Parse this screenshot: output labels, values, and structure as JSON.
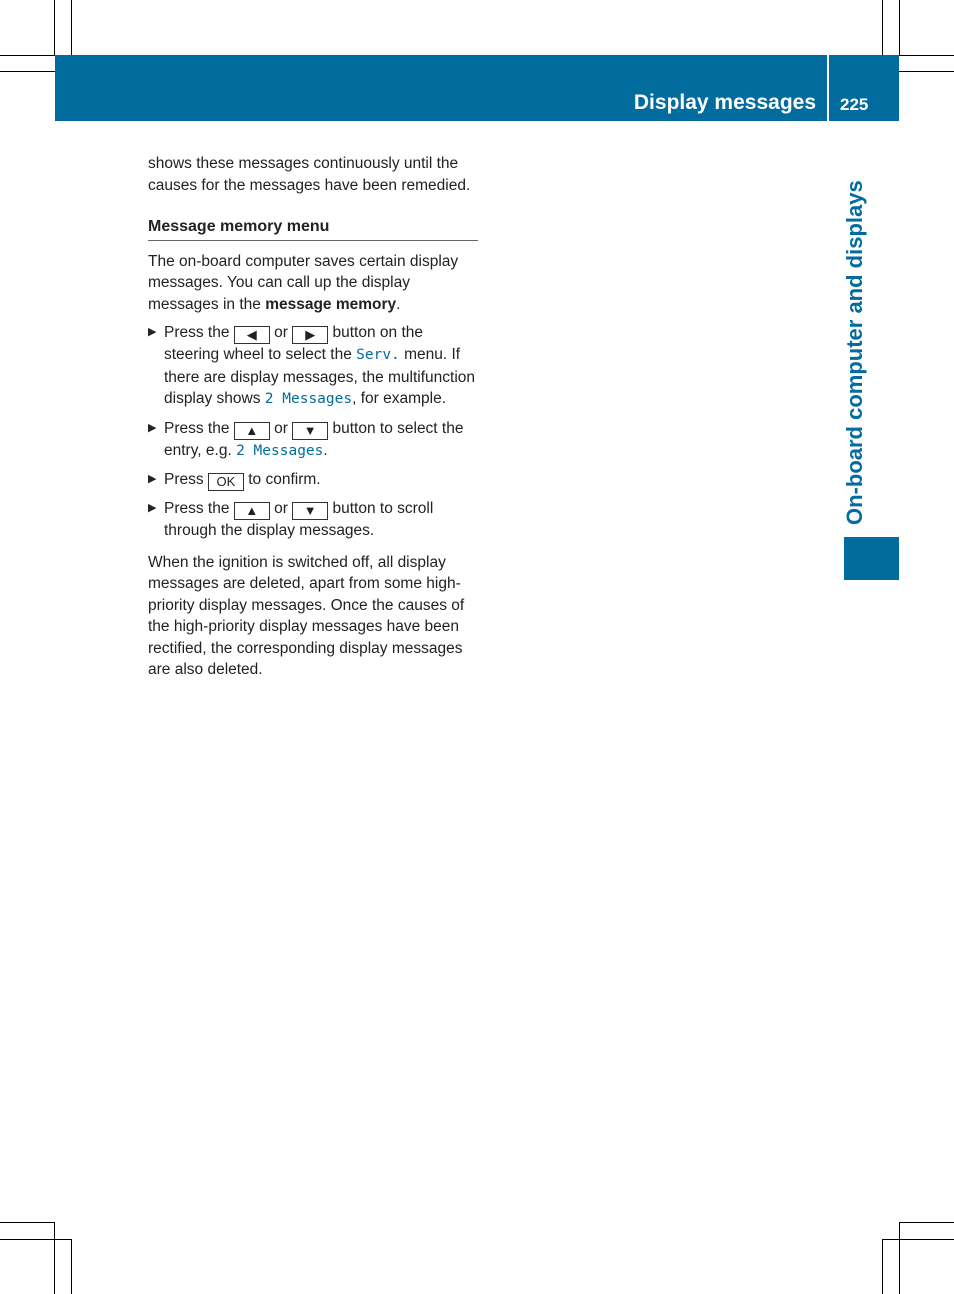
{
  "header": {
    "title": "Display messages",
    "page_number": "225"
  },
  "side_tab": {
    "label": "On-board computer and displays"
  },
  "content": {
    "intro": "shows these messages continuously until the causes for the messages have been remedied.",
    "heading": "Message memory menu",
    "para1_a": "The on-board computer saves certain display messages. You can call up the display messages in the ",
    "para1_bold": "message memory",
    "para1_b": ".",
    "steps": [
      {
        "t1": "Press the ",
        "k1": "◀",
        "or": " or ",
        "k2": "▶",
        "t2": " button on the steering wheel to select the ",
        "m1": "Serv.",
        "t3": " menu. If there are display messages, the multifunction display shows ",
        "m2": "2 Messages",
        "t4": ", for example."
      },
      {
        "t1": "Press the ",
        "k1": "▲",
        "or": " or ",
        "k2": "▼",
        "t2": " button to select the entry, e.g. ",
        "m1": "2 Messages",
        "t3": "."
      },
      {
        "t1": "Press ",
        "k1": "OK",
        "t2": " to confirm."
      },
      {
        "t1": "Press the ",
        "k1": "▲",
        "or": " or ",
        "k2": "▼",
        "t2": " button to scroll through the display messages."
      }
    ],
    "para2": "When the ignition is switched off, all display messages are deleted, apart from some high-priority display messages. Once the causes of the high-priority display messages have been rectified, the corresponding display messages are also deleted."
  },
  "bullet_icon": "▶"
}
